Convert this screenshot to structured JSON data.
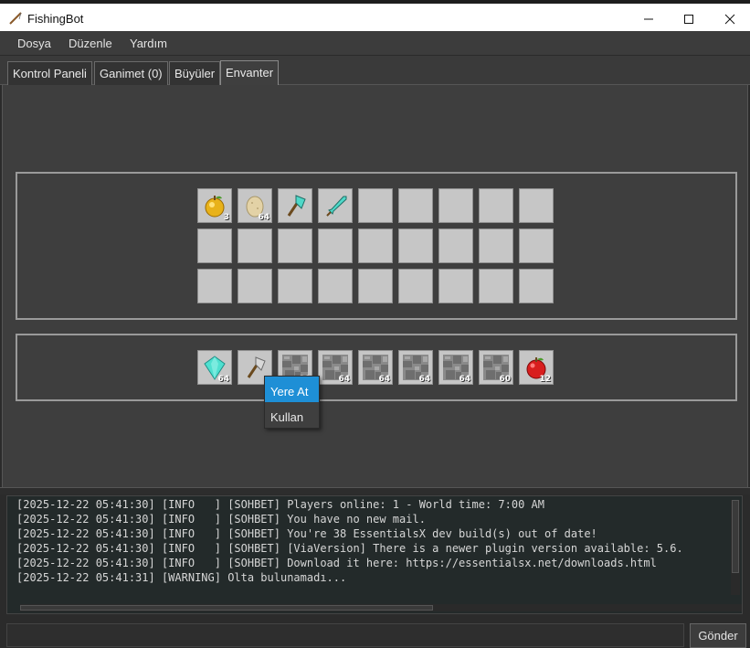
{
  "window": {
    "title": "FishingBot",
    "icon": "fishing-rod-icon",
    "controls": [
      "minimize-icon",
      "maximize-icon",
      "close-icon"
    ]
  },
  "menu": {
    "items": [
      "Dosya",
      "Düzenle",
      "Yardım"
    ]
  },
  "tabs": [
    {
      "label": "Kontrol Paneli",
      "active": false
    },
    {
      "label": "Ganimet (0)",
      "active": false
    },
    {
      "label": "Büyüler",
      "active": false
    },
    {
      "label": "Envanter",
      "active": true
    }
  ],
  "inventory": {
    "main_grid": [
      [
        {
          "item": "golden-apple",
          "count": "3"
        },
        {
          "item": "egg",
          "count": "64"
        },
        {
          "item": "diamond-axe",
          "count": ""
        },
        {
          "item": "diamond-sword",
          "count": ""
        },
        {
          "item": "",
          "count": ""
        },
        {
          "item": "",
          "count": ""
        },
        {
          "item": "",
          "count": ""
        },
        {
          "item": "",
          "count": ""
        },
        {
          "item": "",
          "count": ""
        }
      ],
      [
        {
          "item": "",
          "count": ""
        },
        {
          "item": "",
          "count": ""
        },
        {
          "item": "",
          "count": ""
        },
        {
          "item": "",
          "count": ""
        },
        {
          "item": "",
          "count": ""
        },
        {
          "item": "",
          "count": ""
        },
        {
          "item": "",
          "count": ""
        },
        {
          "item": "",
          "count": ""
        },
        {
          "item": "",
          "count": ""
        }
      ],
      [
        {
          "item": "",
          "count": ""
        },
        {
          "item": "",
          "count": ""
        },
        {
          "item": "",
          "count": ""
        },
        {
          "item": "",
          "count": ""
        },
        {
          "item": "",
          "count": ""
        },
        {
          "item": "",
          "count": ""
        },
        {
          "item": "",
          "count": ""
        },
        {
          "item": "",
          "count": ""
        },
        {
          "item": "",
          "count": ""
        }
      ]
    ],
    "hotbar": [
      {
        "item": "diamond",
        "count": "64"
      },
      {
        "item": "iron-axe",
        "count": ""
      },
      {
        "item": "cobblestone",
        "count": "64"
      },
      {
        "item": "cobblestone",
        "count": "64"
      },
      {
        "item": "cobblestone",
        "count": "64"
      },
      {
        "item": "cobblestone",
        "count": "64"
      },
      {
        "item": "cobblestone",
        "count": "64"
      },
      {
        "item": "cobblestone",
        "count": "60"
      },
      {
        "item": "apple",
        "count": "12"
      }
    ]
  },
  "context_menu": {
    "items": [
      {
        "label": "Yere At",
        "highlighted": true
      },
      {
        "label": "Kullan",
        "highlighted": false
      }
    ]
  },
  "log": {
    "lines": [
      "[2025-12-22 05:41:30] [INFO   ] [SOHBET] Players online: 1 - World time: 7:00 AM",
      "[2025-12-22 05:41:30] [INFO   ] [SOHBET] You have no new mail.",
      "[2025-12-22 05:41:30] [INFO   ] [SOHBET] You're 38 EssentialsX dev build(s) out of date!",
      "[2025-12-22 05:41:30] [INFO   ] [SOHBET] [ViaVersion] There is a newer plugin version available: 5.6.",
      "[2025-12-22 05:41:30] [INFO   ] [SOHBET] Download it here: https://essentialsx.net/downloads.html",
      "[2025-12-22 05:41:31] [WARNING] Olta bulunamadı..."
    ]
  },
  "input": {
    "value": "",
    "send_label": "Gönder"
  },
  "colors": {
    "accent": "#1e8fd6",
    "panel": "#3e3e3e",
    "slot": "#c6c6c6"
  }
}
